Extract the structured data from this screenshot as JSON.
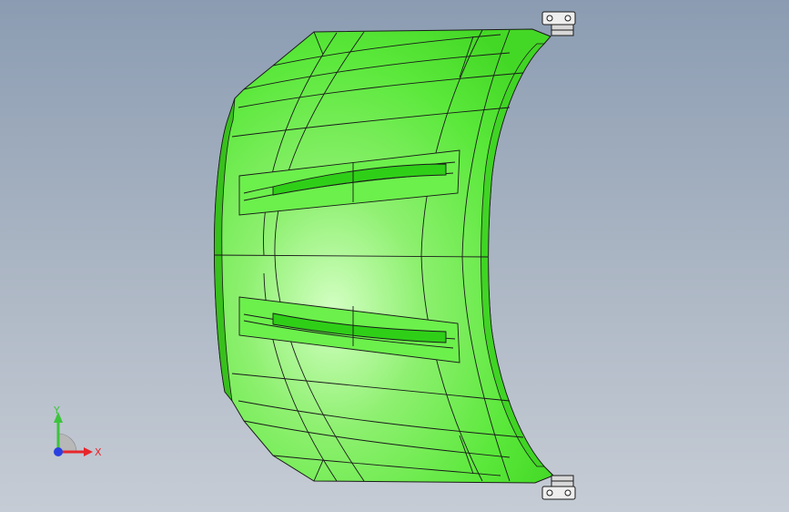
{
  "colors": {
    "background_top": "#8b9cb2",
    "background_bottom": "#c6ccd5",
    "body_fill": "#66ee44",
    "body_highlight": "#c8ffb4",
    "edge": "#1a1a1a",
    "hinge": "#e8e8e8",
    "axis_x": "#e8262b",
    "axis_y": "#3cc43c",
    "axis_z": "#2a3fe0"
  },
  "icons": {
    "triad": "view-orientation-triad-icon",
    "hinge": "hinge-bracket-icon"
  },
  "triad": {
    "x_label": "X",
    "y_label": "Y"
  }
}
